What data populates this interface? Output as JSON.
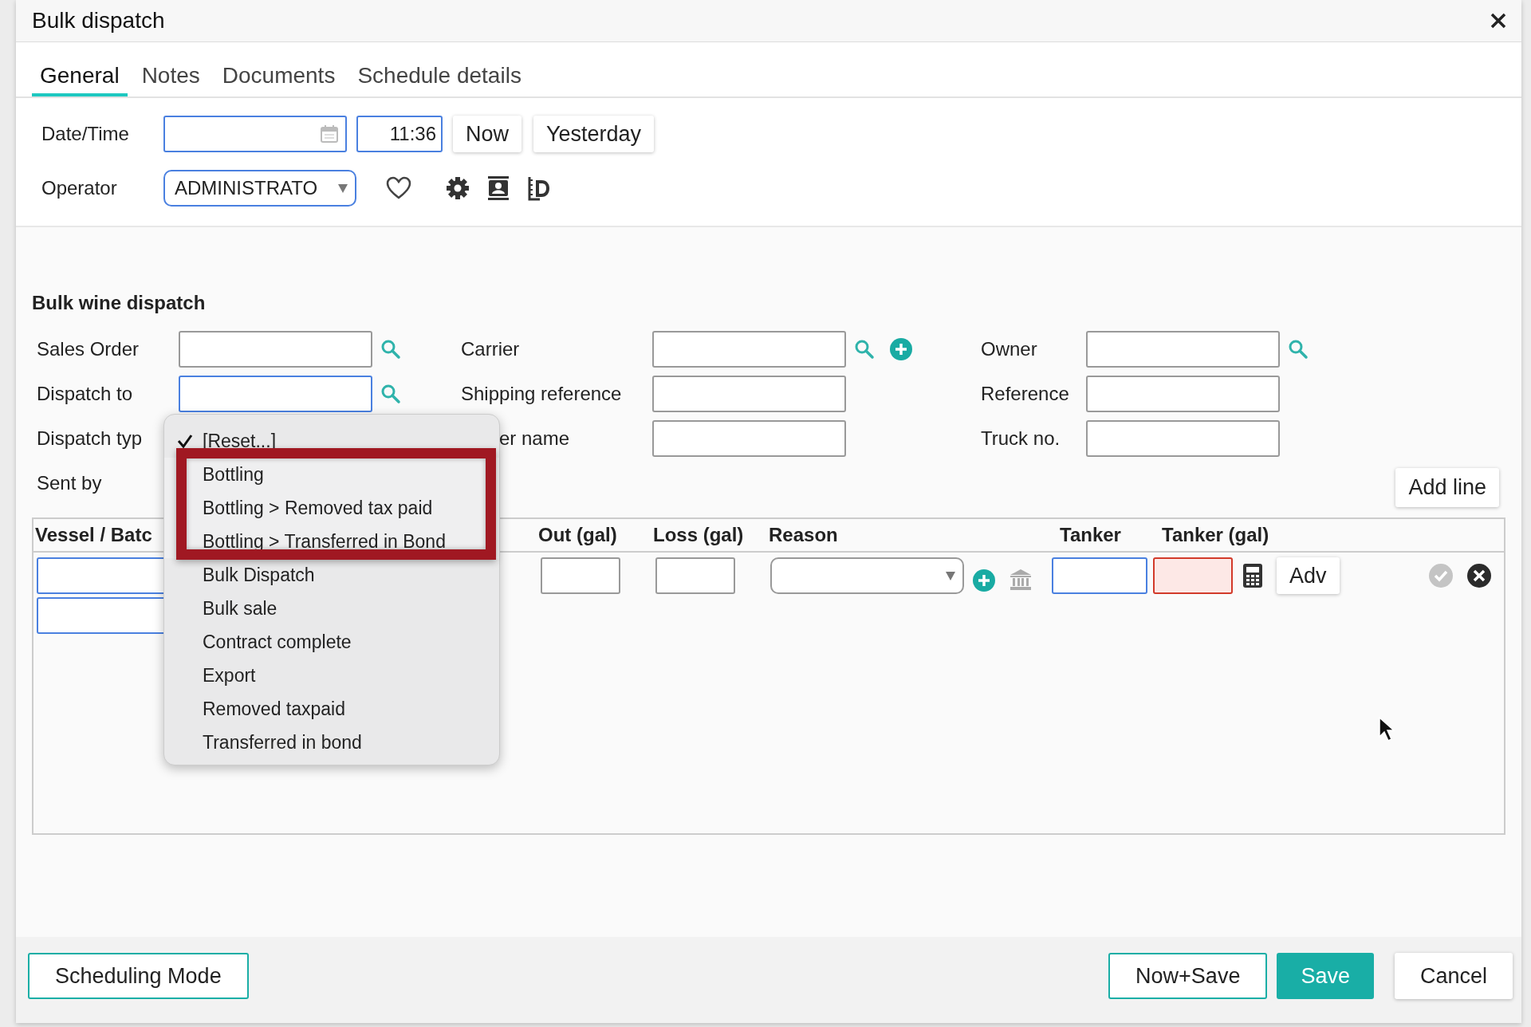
{
  "dialog": {
    "title": "Bulk dispatch"
  },
  "tabs": [
    {
      "label": "General",
      "selected": true
    },
    {
      "label": "Notes",
      "selected": false
    },
    {
      "label": "Documents",
      "selected": false
    },
    {
      "label": "Schedule details",
      "selected": false
    }
  ],
  "date_time": {
    "label": "Date/Time",
    "time": "11:36",
    "buttons": [
      "Now",
      "Yesterday"
    ]
  },
  "operator": {
    "label": "Operator",
    "value": "ADMINISTRATO"
  },
  "section": {
    "heading": "Bulk wine dispatch"
  },
  "form_columns": [
    [
      {
        "label": "Sales Order",
        "kind": "field",
        "required": false,
        "search": true,
        "add": false
      },
      {
        "label": "Dispatch to",
        "kind": "field",
        "required": true,
        "search": true,
        "add": false
      },
      {
        "label": "Dispatch typ",
        "kind": "label"
      },
      {
        "label": "Sent by",
        "kind": "label"
      }
    ],
    [
      {
        "label": "Carrier",
        "kind": "field",
        "required": false,
        "search": true,
        "add": true
      },
      {
        "label": "Shipping reference",
        "kind": "field",
        "required": false,
        "search": false,
        "add": false
      },
      {
        "label": "er name",
        "kind": "field",
        "required": false,
        "search": false,
        "add": false
      }
    ],
    [
      {
        "label": "Owner",
        "kind": "field",
        "required": false,
        "search": true,
        "add": false
      },
      {
        "label": "Reference",
        "kind": "field",
        "required": false,
        "search": false,
        "add": false
      },
      {
        "label": "Truck no.",
        "kind": "field",
        "required": false,
        "search": false,
        "add": false
      }
    ]
  ],
  "add_line": "Add line",
  "table": {
    "columns": [
      "Vessel / Batc",
      "Out (gal)",
      "Loss (gal)",
      "Reason",
      "Tanker",
      "Tanker (gal)"
    ],
    "row": {
      "tanker_gal_invalid": true,
      "action": "Adv"
    }
  },
  "dispatch_type_menu": [
    {
      "label": "[Reset...]",
      "checked": true,
      "highlighted": false
    },
    {
      "label": "Bottling",
      "checked": false,
      "highlighted": true
    },
    {
      "label": "Bottling > Removed tax paid",
      "checked": false,
      "highlighted": true
    },
    {
      "label": "Bottling > Transferred in Bond",
      "checked": false,
      "highlighted": true
    },
    {
      "label": "Bulk Dispatch",
      "checked": false,
      "highlighted": false
    },
    {
      "label": "Bulk sale",
      "checked": false,
      "highlighted": false
    },
    {
      "label": "Contract complete",
      "checked": false,
      "highlighted": false
    },
    {
      "label": "Export",
      "checked": false,
      "highlighted": false
    },
    {
      "label": "Removed taxpaid",
      "checked": false,
      "highlighted": false
    },
    {
      "label": "Transferred in bond",
      "checked": false,
      "highlighted": false
    }
  ],
  "footer": {
    "left": "Scheduling Mode",
    "buttons": [
      {
        "label": "Now+Save",
        "kind": "outline"
      },
      {
        "label": "Save",
        "kind": "primary"
      },
      {
        "label": "Cancel",
        "kind": "plain"
      }
    ]
  }
}
